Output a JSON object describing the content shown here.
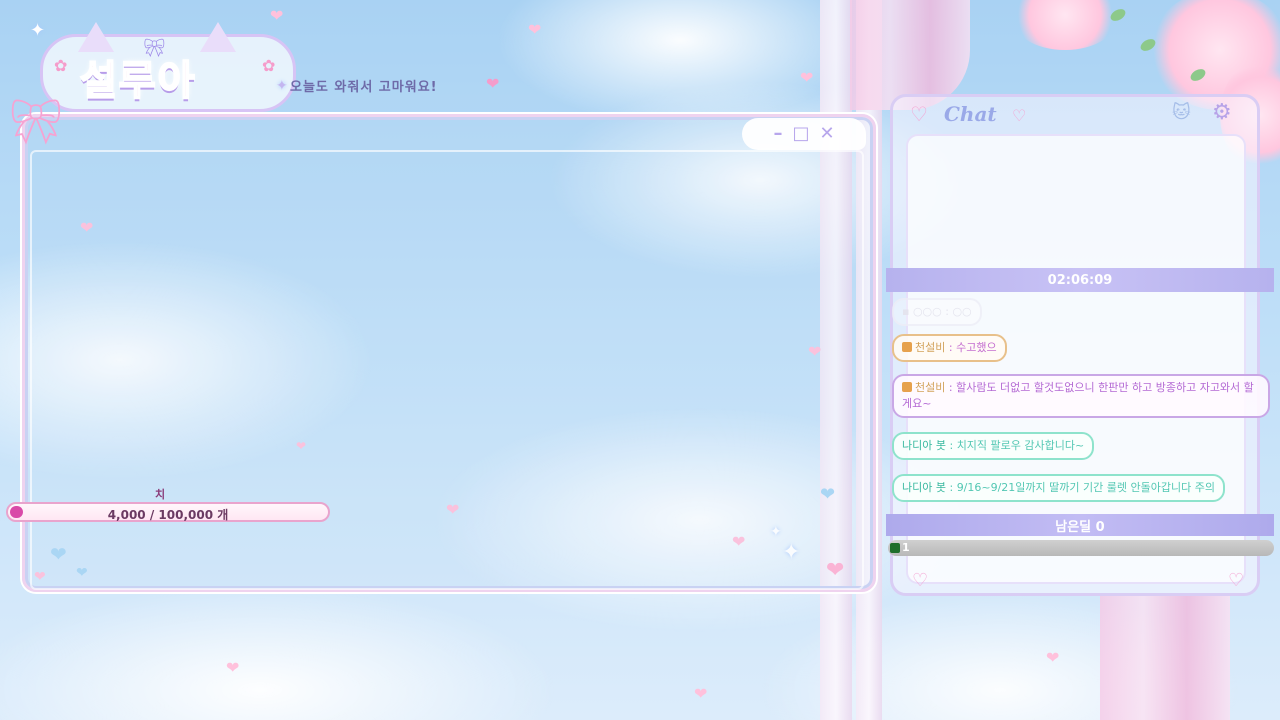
{
  "logo": {
    "title": "설루아",
    "greeting": "오늘도 와줘서 고마워요!"
  },
  "window": {
    "controls": {
      "minimize": "–",
      "maximize": "□",
      "close": "✕"
    }
  },
  "cheese": {
    "label": "치즈",
    "current": 4000,
    "goal": 100000,
    "text": "4,000 / 100,000 개"
  },
  "chat": {
    "title": "Chat",
    "timer": "02:06:09",
    "messages": [
      {
        "style": "faded",
        "text": "▪ ○○○ : ○○"
      },
      {
        "style": "gold",
        "sender": "천설비",
        "sep": " : ",
        "text": "수고했으"
      },
      {
        "style": "purple",
        "sender": "천설비",
        "sep": " : ",
        "text": "할사람도 더없고 할것도없으니 한판만 하고 방종하고 자고와서 할게요~"
      },
      {
        "style": "mint",
        "sender": "나디아 봇",
        "sep": " : ",
        "text": "치지직 팔로우 감사합니다~"
      },
      {
        "style": "mint",
        "sender": "나디아 봇",
        "sep": " : ",
        "text": "9/16~9/21일까지 딸까기 기간 룰렛 안돌아갑니다 주의"
      }
    ],
    "remaining": {
      "label": "남은딜 0",
      "count": "1"
    }
  },
  "colors": {
    "accent_pink": "#f49cd0",
    "accent_lavender": "#b6b2ee",
    "mint": "#8ee3cc"
  }
}
